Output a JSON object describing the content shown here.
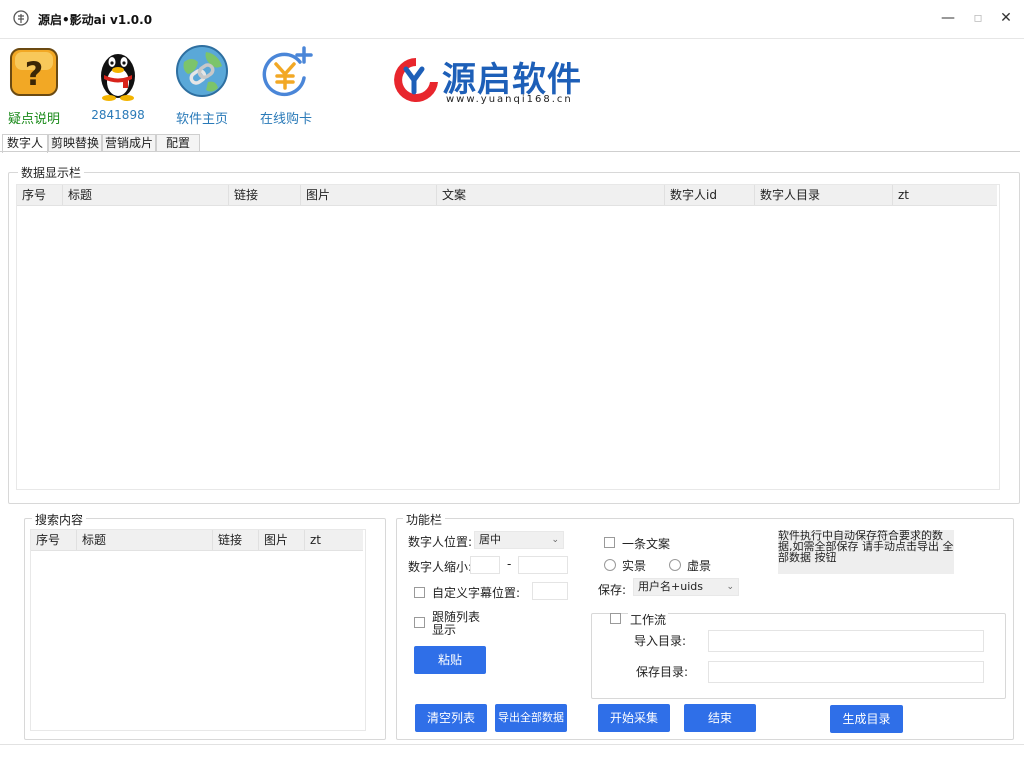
{
  "window": {
    "title": "源启•影动ai v1.0.0",
    "min_glyph": "—",
    "max_glyph": "▫",
    "close_glyph": "✕"
  },
  "toolbar": {
    "items": [
      {
        "label": "疑点说明",
        "color": "#1a8a1a",
        "icon": "help-icon"
      },
      {
        "label": "2841898",
        "color": "#2a7ab8",
        "icon": "qq-penguin-icon"
      },
      {
        "label": "软件主页",
        "color": "#2a7ab8",
        "icon": "globe-link-icon"
      },
      {
        "label": "在线购卡",
        "color": "#2a7ab8",
        "icon": "yen-add-icon"
      }
    ],
    "logo": {
      "brand": "源启软件",
      "url": "www.yuanqi168.cn",
      "brand_color": "#1d5fb8",
      "accent": "#e8262d"
    }
  },
  "tabs": [
    "数字人",
    "剪映替换",
    "营销成片",
    "配置"
  ],
  "data_panel": {
    "title": "数据显示栏",
    "columns": [
      "序号",
      "标题",
      "链接",
      "图片",
      "文案",
      "数字人id",
      "数字人目录",
      "zt"
    ]
  },
  "search_panel": {
    "title": "搜索内容",
    "columns": [
      "序号",
      "标题",
      "链接",
      "图片",
      "zt"
    ]
  },
  "function_panel": {
    "title": "功能栏",
    "position_label": "数字人位置:",
    "position_value": "居中",
    "scale_label": "数字人缩小:",
    "scale_dash": "-",
    "custom_subtitle_label": "自定义字幕位置:",
    "follow_list_label": "跟随列表显示",
    "paste_button": "粘贴",
    "one_copy_label": "一条文案",
    "real_scene_label": "实景",
    "virtual_scene_label": "虚景",
    "save_label": "保存:",
    "save_value": "用户名+uids",
    "info_text": "软件执行中自动保存符合要求的数据,如需全部保存 请手动点击导出 全部数据 按钮",
    "workflow_label": "工作流",
    "import_dir_label": "导入目录:",
    "save_dir_label": "保存目录:",
    "buttons": {
      "clear": "清空列表",
      "export": "导出全部数据",
      "start": "开始采集",
      "end": "结束",
      "generate": "生成目录"
    }
  }
}
